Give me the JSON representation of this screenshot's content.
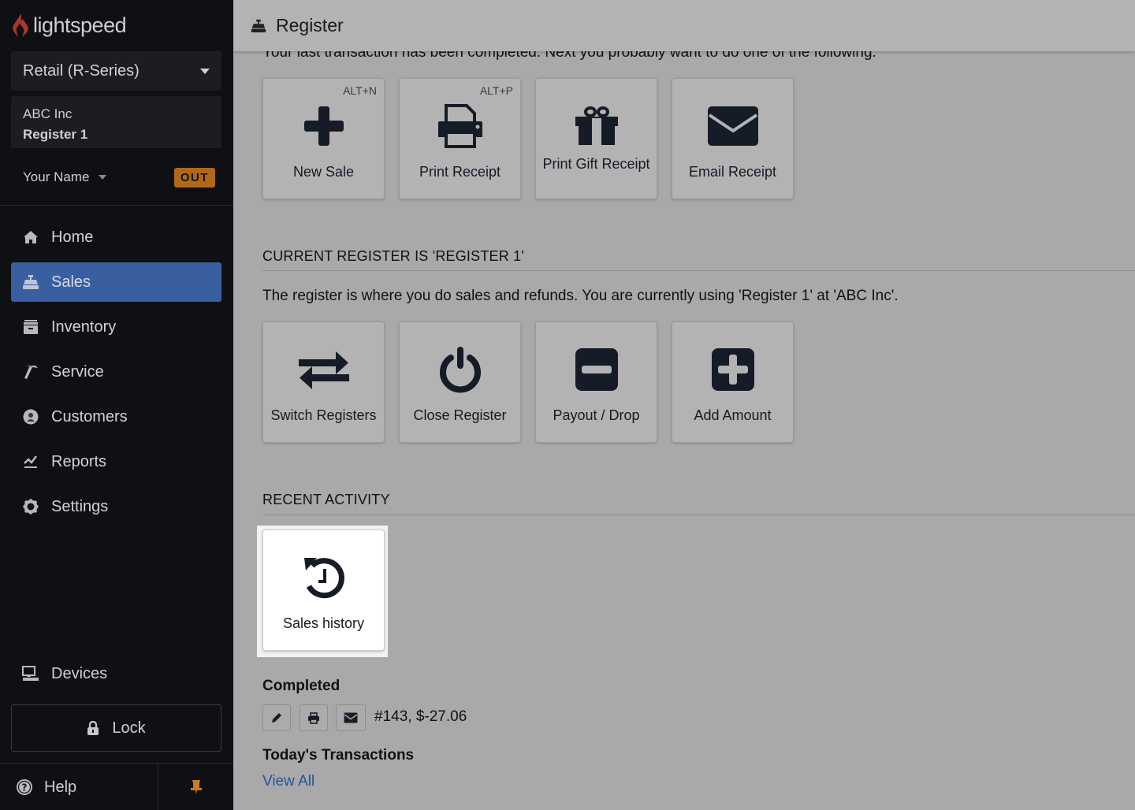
{
  "app": {
    "logo_text": "lightspeed",
    "brand_color": "#c9433b"
  },
  "sidebar": {
    "product_selector": "Retail (R-Series)",
    "shop_name": "ABC Inc",
    "register_name": "Register 1",
    "user_name": "Your Name",
    "clock_badge": "OUT",
    "badge_color": "#b0681a",
    "active_color": "#3a5fa0",
    "nav": [
      {
        "label": "Home",
        "icon": "home-icon"
      },
      {
        "label": "Sales",
        "icon": "cash-register-icon",
        "active": true
      },
      {
        "label": "Inventory",
        "icon": "inventory-icon"
      },
      {
        "label": "Service",
        "icon": "hammer-icon"
      },
      {
        "label": "Customers",
        "icon": "user-circle-icon"
      },
      {
        "label": "Reports",
        "icon": "chart-line-icon"
      },
      {
        "label": "Settings",
        "icon": "gear-icon"
      }
    ],
    "devices_label": "Devices",
    "lock_label": "Lock",
    "help_label": "Help"
  },
  "header": {
    "title": "Register"
  },
  "main": {
    "intro": "Your last transaction has been completed. Next you probably want to do one of the following:",
    "next_actions": [
      {
        "label": "New Sale",
        "shortcut": "ALT+N",
        "icon": "plus-icon"
      },
      {
        "label": "Print Receipt",
        "shortcut": "ALT+P",
        "icon": "printer-icon"
      },
      {
        "label": "Print Gift Receipt",
        "icon": "gift-icon"
      },
      {
        "label": "Email Receipt",
        "icon": "envelope-icon"
      }
    ],
    "register_section": {
      "heading": "CURRENT REGISTER IS 'REGISTER 1'",
      "description": "The register is where you do sales and refunds. You are currently using 'Register 1'  at 'ABC Inc'.",
      "actions": [
        {
          "label": "Switch Registers",
          "icon": "exchange-icon"
        },
        {
          "label": "Close Register",
          "icon": "power-icon"
        },
        {
          "label": "Payout / Drop",
          "icon": "minus-square-icon"
        },
        {
          "label": "Add Amount",
          "icon": "plus-square-icon"
        }
      ]
    },
    "recent_activity": {
      "heading": "RECENT ACTIVITY",
      "sales_history_label": "Sales history",
      "completed_heading": "Completed",
      "transaction": "#143, $-27.06",
      "today_heading": "Today's Transactions",
      "view_all_label": "View All",
      "link_color": "#1f54a3"
    }
  }
}
